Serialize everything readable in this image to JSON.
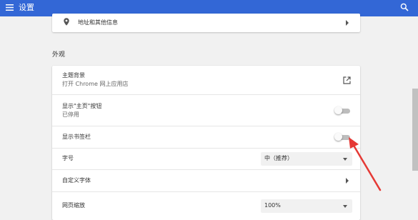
{
  "header": {
    "title": "设置",
    "menu_icon": "hamburger-menu-icon",
    "search_icon": "search-icon",
    "background_color": "#3367d6"
  },
  "autofill": {
    "address_label": "地址和其他信息",
    "icon": "location-pin-icon"
  },
  "appearance": {
    "section_title": "外观",
    "theme": {
      "label": "主题背景",
      "sublabel": "打开 Chrome 网上应用店",
      "icon": "open-in-new-icon"
    },
    "home_button": {
      "label": "显示\"主页\"按钮",
      "sublabel": "已停用",
      "enabled": false
    },
    "bookmarks_bar": {
      "label": "显示书签栏",
      "enabled": false
    },
    "font_size": {
      "label": "字号",
      "value": "中（推荐）"
    },
    "custom_fonts": {
      "label": "自定义字体"
    },
    "page_zoom": {
      "label": "网页缩放",
      "value": "100%"
    }
  },
  "annotation": {
    "arrow_color": "#e53935",
    "points_to": "bookmarks_bar toggle"
  }
}
